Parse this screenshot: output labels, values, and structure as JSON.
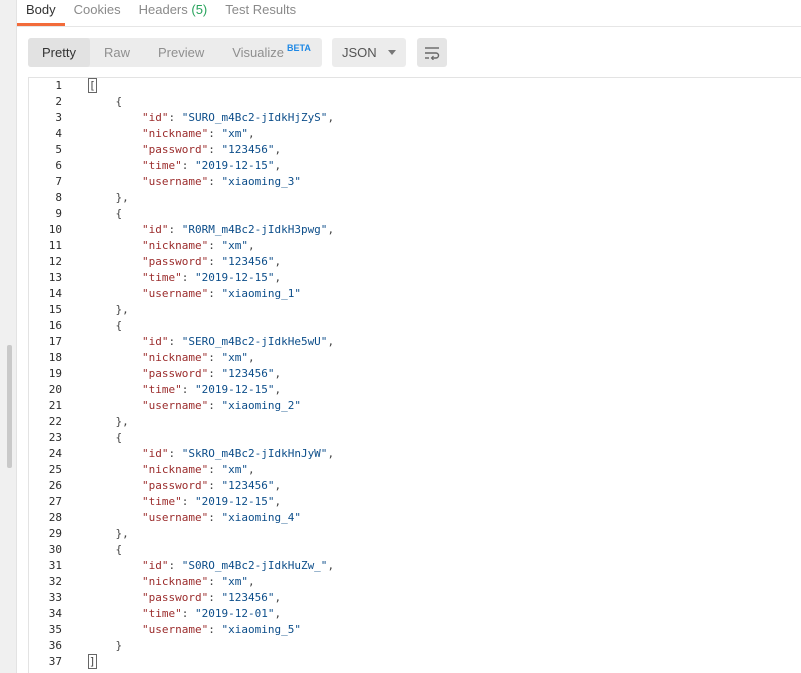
{
  "tabs": [
    {
      "label": "Body",
      "active": true
    },
    {
      "label": "Cookies"
    },
    {
      "label": "Headers",
      "count": "(5)"
    },
    {
      "label": "Test Results"
    }
  ],
  "toolbar": {
    "views": [
      "Pretty",
      "Raw",
      "Preview",
      "Visualize"
    ],
    "beta_label": "BETA",
    "format": "JSON"
  },
  "colors": {
    "accent": "#f26b3a",
    "count_green": "#27a35c",
    "json_key": "#9b2c2c",
    "json_string": "#0d4e8a"
  },
  "icons": {
    "wrap": "wrap-lines-icon",
    "dropdown": "chevron-down-icon"
  },
  "records": [
    {
      "id": "SURO_m4Bc2-jIdkHjZyS",
      "nickname": "xm",
      "password": "123456",
      "time": "2019-12-15",
      "username": "xiaoming_3"
    },
    {
      "id": "R0RM_m4Bc2-jIdkH3pwg",
      "nickname": "xm",
      "password": "123456",
      "time": "2019-12-15",
      "username": "xiaoming_1"
    },
    {
      "id": "SERO_m4Bc2-jIdkHe5wU",
      "nickname": "xm",
      "password": "123456",
      "time": "2019-12-15",
      "username": "xiaoming_2"
    },
    {
      "id": "SkRO_m4Bc2-jIdkHnJyW",
      "nickname": "xm",
      "password": "123456",
      "time": "2019-12-15",
      "username": "xiaoming_4"
    },
    {
      "id": "S0RO_m4Bc2-jIdkHuZw_",
      "nickname": "xm",
      "password": "123456",
      "time": "2019-12-01",
      "username": "xiaoming_5"
    }
  ]
}
